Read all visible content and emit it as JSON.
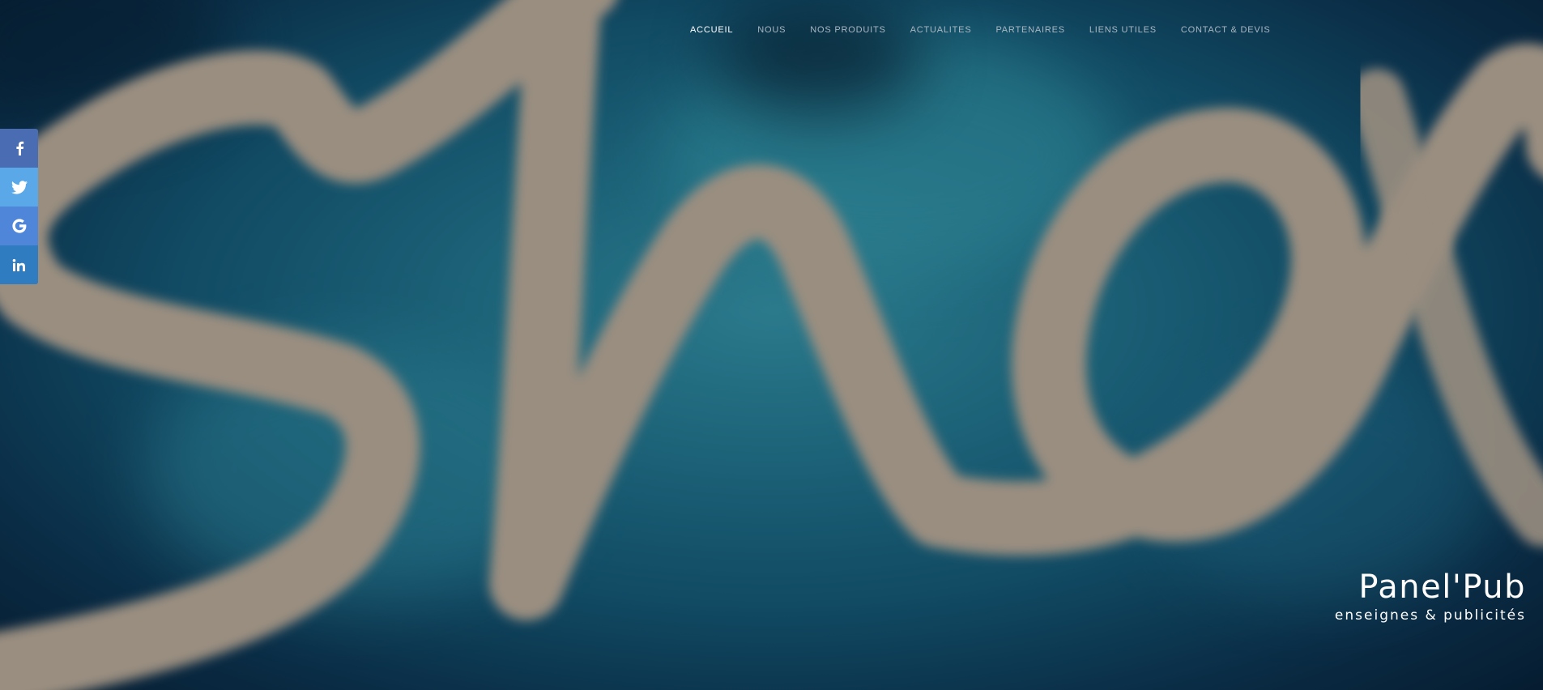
{
  "nav": {
    "items": [
      {
        "label": "ACCUEIL",
        "active": true
      },
      {
        "label": "NOUS",
        "active": false
      },
      {
        "label": "NOS PRODUITS",
        "active": false
      },
      {
        "label": "ACTUALITES",
        "active": false
      },
      {
        "label": "PARTENAIRES",
        "active": false
      },
      {
        "label": "LIENS UTILES",
        "active": false
      },
      {
        "label": "CONTACT & DEVIS",
        "active": false
      }
    ]
  },
  "social": {
    "items": [
      {
        "icon": "facebook-icon",
        "color": "#4a6cb2"
      },
      {
        "icon": "twitter-icon",
        "color": "#5aa8e8"
      },
      {
        "icon": "google-icon",
        "color": "#4f86d9"
      },
      {
        "icon": "linkedin-icon",
        "color": "#2f7cc0"
      }
    ]
  },
  "brand": {
    "title": "Panel'Pub",
    "subtitle": "enseignes & publicités"
  },
  "colors": {
    "background": "#114a63",
    "script_stroke": "#9a8e80",
    "nav_active": "#ffffff",
    "nav_inactive": "#a9b7c2"
  }
}
